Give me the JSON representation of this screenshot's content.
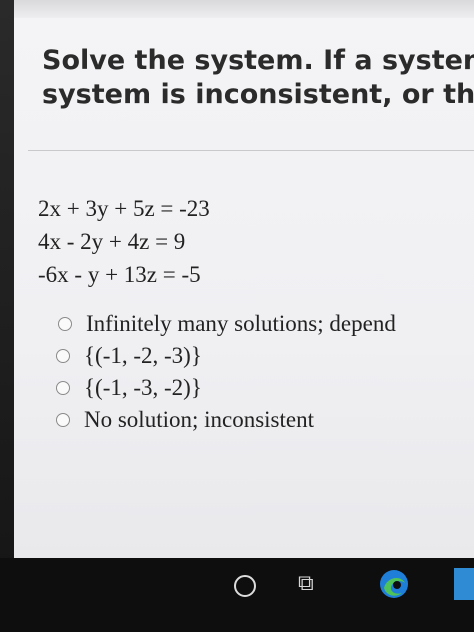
{
  "question": {
    "header_line1": "Solve the system. If a system",
    "header_line2": "system is inconsistent, or th"
  },
  "equations": [
    "2x + 3y + 5z = -23",
    "4x - 2y + 4z = 9",
    "-6x - y + 13z = -5"
  ],
  "options": [
    "Infinitely many solutions; depend",
    "{(-1, -2, -3)}",
    "{(-1, -3, -2)}",
    "No solution; inconsistent"
  ],
  "taskbar": {
    "icons": [
      "search-icon",
      "task-view-icon",
      "edge-browser-icon",
      "pinned-app-icon"
    ],
    "colors": {
      "edge_blue": "#1f7fd8",
      "edge_green": "#4fc25a"
    }
  }
}
